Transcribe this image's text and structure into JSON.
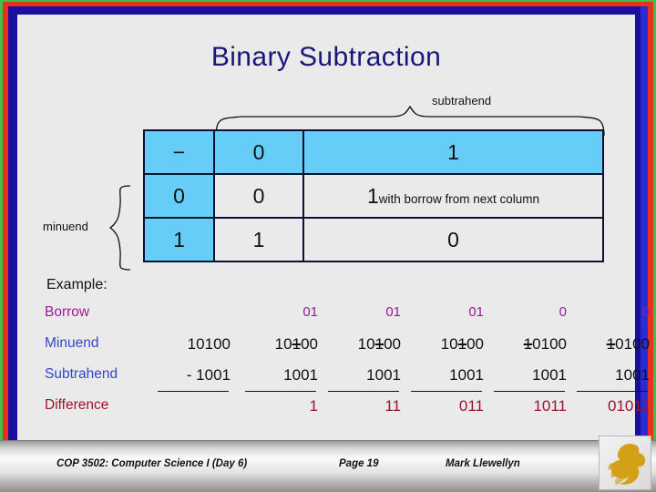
{
  "slide": {
    "title": "Binary Subtraction",
    "example_label": "Example:"
  },
  "colors": {
    "title": "#18187a",
    "table_highlight": "#66ccf8",
    "borrow": "#a0179b",
    "operand": "#3844c9",
    "difference": "#9e1230",
    "frame_green": "#3fc04a",
    "frame_red": "#e8301d",
    "frame_navy": "#1a0f9e",
    "canvas": "#eaeaea",
    "logo_gold": "#d4a017"
  },
  "braces": {
    "subtrahend_label": "subtrahend",
    "minuend_label": "minuend"
  },
  "rule_table": {
    "header": [
      "−",
      "0",
      "1"
    ],
    "rows": [
      {
        "minuend": "0",
        "results": [
          "0",
          "1"
        ],
        "note": "with borrow from next column"
      },
      {
        "minuend": "1",
        "results": [
          "1",
          "0"
        ],
        "note": ""
      }
    ]
  },
  "example": {
    "row_labels": {
      "borrow": "Borrow",
      "minuend": "Minuend",
      "subtrahend": "Subtrahend",
      "difference": "Difference"
    },
    "columns": [
      {
        "borrow": "",
        "minuend": "10100",
        "minuend_struck": [],
        "subtrahend": "- 1001",
        "difference": "",
        "rule": true
      },
      {
        "borrow": "01",
        "minuend": "10100",
        "minuend_struck": [
          2
        ],
        "subtrahend": "1001",
        "difference": "1",
        "rule": true
      },
      {
        "borrow": "01",
        "minuend": "10100",
        "minuend_struck": [
          2
        ],
        "subtrahend": "1001",
        "difference": "11",
        "rule": true
      },
      {
        "borrow": "01",
        "minuend": "10100",
        "minuend_struck": [
          2
        ],
        "subtrahend": "1001",
        "difference": "011",
        "rule": true
      },
      {
        "borrow": "0",
        "minuend": "10100",
        "minuend_struck": [
          0
        ],
        "subtrahend": "1001",
        "difference": "1011",
        "rule": true
      },
      {
        "borrow": "0",
        "minuend": "10100",
        "minuend_struck": [
          0
        ],
        "subtrahend": "1001",
        "difference": "01011",
        "rule": true
      }
    ]
  },
  "footer": {
    "course": "COP 3502: Computer Science I  (Day 6)",
    "page": "Page 19",
    "author": "Mark Llewellyn",
    "logo": "ucf-pegasus-logo"
  }
}
